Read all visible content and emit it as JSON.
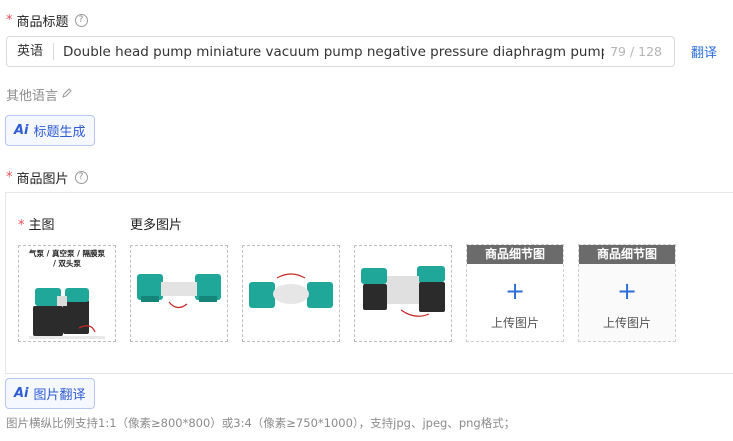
{
  "product_title": {
    "label": "商品标题",
    "required_mark": "*",
    "help_icon": "question-circle-icon",
    "language": "英语",
    "value": "Double head pump miniature vacuum pump negative pressure diaphragm pump",
    "counter": "79 / 128",
    "translate_link": "翻译"
  },
  "other_languages": {
    "label": "其他语言",
    "icon": "edit-icon"
  },
  "ai_title_button": {
    "ai_mark": "Ai",
    "label": "标题生成"
  },
  "product_images": {
    "label": "商品图片",
    "required_mark": "*",
    "help_icon": "question-circle-icon",
    "main_label": "主图",
    "more_label": "更多图片",
    "main_image_caption": "气泵 / 真空泵 / 隔膜泵 / 双头泵",
    "detail_slots": [
      {
        "header": "商品细节图",
        "plus": "+",
        "label": "上传图片"
      },
      {
        "header": "商品细节图",
        "plus": "+",
        "label": "上传图片"
      }
    ]
  },
  "ai_image_button": {
    "ai_mark": "Ai",
    "label": "图片翻译"
  },
  "hint": "图片横纵比例支持1:1（像素≥800*800）或3:4（像素≥750*1000），支持jpg、jpeg、png格式；",
  "colors": {
    "accent": "#2b6fdb",
    "required": "#e34d59",
    "pump_teal": "#1fa89a",
    "pump_black": "#2b2b2b"
  }
}
